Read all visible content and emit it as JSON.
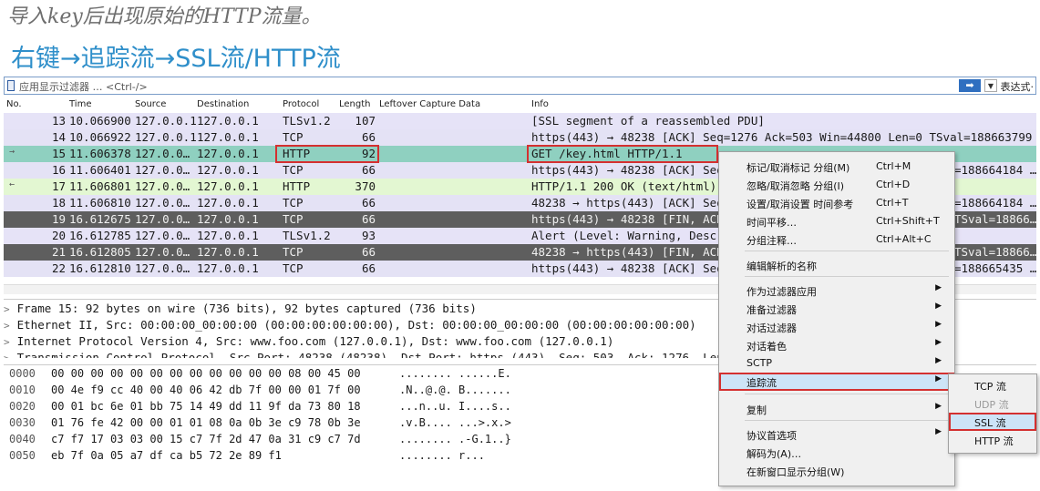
{
  "captions": {
    "line1": "导入key后出现原始的HTTP流量。",
    "line2": "右键→追踪流→SSL流/HTTP流"
  },
  "filter": {
    "placeholder": "应用显示过滤器 … <Ctrl-/>",
    "apply_icon": "right-arrow-icon",
    "expression_label": "表达式·"
  },
  "columns": [
    "No.",
    "Time",
    "Source",
    "Destination",
    "Protocol",
    "Length",
    "Leftover Capture Data",
    "Info"
  ],
  "packets": [
    {
      "no": "13",
      "time": "10.066900",
      "src": "127.0.0.1",
      "dst": "127.0.0.1",
      "proto": "TLSv1.2",
      "len": "107",
      "info": "[SSL segment of a reassembled PDU]"
    },
    {
      "no": "14",
      "time": "10.066922",
      "src": "127.0.0.1",
      "dst": "127.0.0.1",
      "proto": "TCP",
      "len": "66",
      "info": "https(443) → 48238 [ACK] Seq=1276 Ack=503 Win=44800 Len=0 TSval=188663799 …"
    },
    {
      "no": "15",
      "time": "11.606378",
      "src": "127.0.0…",
      "dst": "127.0.0.1",
      "proto": "HTTP",
      "len": "92",
      "info": "GET /key.html HTTP/1.1"
    },
    {
      "no": "16",
      "time": "11.606401",
      "src": "127.0.0…",
      "dst": "127.0.0.1",
      "proto": "TCP",
      "len": "66",
      "info": "https(443) → 48238 [ACK] Seq",
      "info_tail": "=188664184 …"
    },
    {
      "no": "17",
      "time": "11.606801",
      "src": "127.0.0…",
      "dst": "127.0.0.1",
      "proto": "HTTP",
      "len": "370",
      "info": "HTTP/1.1 200 OK  (text/html)"
    },
    {
      "no": "18",
      "time": "11.606810",
      "src": "127.0.0…",
      "dst": "127.0.0.1",
      "proto": "TCP",
      "len": "66",
      "info": "48238 → https(443) [ACK] Seq",
      "info_tail": "=188664184 …"
    },
    {
      "no": "19",
      "time": "16.612675",
      "src": "127.0.0…",
      "dst": "127.0.0.1",
      "proto": "TCP",
      "len": "66",
      "info": "https(443) → 48238 [FIN, ACK",
      "info_tail": "TSval=18866…"
    },
    {
      "no": "20",
      "time": "16.612785",
      "src": "127.0.0…",
      "dst": "127.0.0.1",
      "proto": "TLSv1.2",
      "len": "93",
      "info": "Alert (Level: Warning, Descr"
    },
    {
      "no": "21",
      "time": "16.612805",
      "src": "127.0.0…",
      "dst": "127.0.0.1",
      "proto": "TCP",
      "len": "66",
      "info": "48238 → https(443) [FIN, ACK",
      "info_tail": "TSval=18866…"
    },
    {
      "no": "22",
      "time": "16.612810",
      "src": "127.0.0…",
      "dst": "127.0.0.1",
      "proto": "TCP",
      "len": "66",
      "info": "https(443) → 48238 [ACK] Seq",
      "info_tail": "=188665435 …"
    }
  ],
  "details": [
    "Frame 15: 92 bytes on wire (736 bits), 92 bytes captured (736 bits)",
    "Ethernet II, Src: 00:00:00_00:00:00 (00:00:00:00:00:00), Dst: 00:00:00_00:00:00 (00:00:00:00:00:00)",
    "Internet Protocol Version 4, Src: www.foo.com (127.0.0.1), Dst: www.foo.com (127.0.0.1)",
    "Transmission Control Protocol, Src Port: 48238 (48238), Dst Port: https (443), Seq: 503, Ack: 1276, Len…"
  ],
  "bytes": [
    {
      "off": "0000",
      "hex": "00 00 00 00 00 00 00 00  00 00 00 00 08 00 45 00",
      "ascii": "........ ......E."
    },
    {
      "off": "0010",
      "hex": "00 4e f9 cc 40 00 40 06  42 db 7f 00 00 01 7f 00",
      "ascii": ".N..@.@. B......."
    },
    {
      "off": "0020",
      "hex": "00 01 bc 6e 01 bb 75 14  49 dd 11 9f da 73 80 18",
      "ascii": "...n..u. I....s.."
    },
    {
      "off": "0030",
      "hex": "01 76 fe 42 00 00 01 01  08 0a 0b 3e c9 78 0b 3e",
      "ascii": ".v.B.... ...>.x.>"
    },
    {
      "off": "0040",
      "hex": "c7 f7 17 03 03 00 15 c7  7f 2d 47 0a 31 c9 c7 7d",
      "ascii": "........ .-G.1..}"
    },
    {
      "off": "0050",
      "hex": "eb 7f 0a 05 a7 df ca b5  72 2e 89 f1",
      "ascii": "........ r..."
    }
  ],
  "context_menu": {
    "items": [
      {
        "label": "标记/取消标记 分组(M)",
        "shortcut": "Ctrl+M"
      },
      {
        "label": "忽略/取消忽略 分组(I)",
        "shortcut": "Ctrl+D"
      },
      {
        "label": "设置/取消设置 时间参考",
        "shortcut": "Ctrl+T"
      },
      {
        "label": "时间平移…",
        "shortcut": "Ctrl+Shift+T"
      },
      {
        "label": "分组注释…",
        "shortcut": "Ctrl+Alt+C"
      },
      {
        "label": "编辑解析的名称"
      },
      {
        "label": "作为过滤器应用"
      },
      {
        "label": "准备过滤器"
      },
      {
        "label": "对话过滤器"
      },
      {
        "label": "对话着色"
      },
      {
        "label": "SCTP"
      },
      {
        "label": "追踪流"
      },
      {
        "label": "复制"
      },
      {
        "label": "协议首选项"
      },
      {
        "label": "解码为(A)…"
      },
      {
        "label": "在新窗口显示分组(W)"
      }
    ]
  },
  "submenu": {
    "items": [
      {
        "label": "TCP 流"
      },
      {
        "label": "UDP 流"
      },
      {
        "label": "SSL 流"
      },
      {
        "label": "HTTP 流"
      }
    ]
  }
}
